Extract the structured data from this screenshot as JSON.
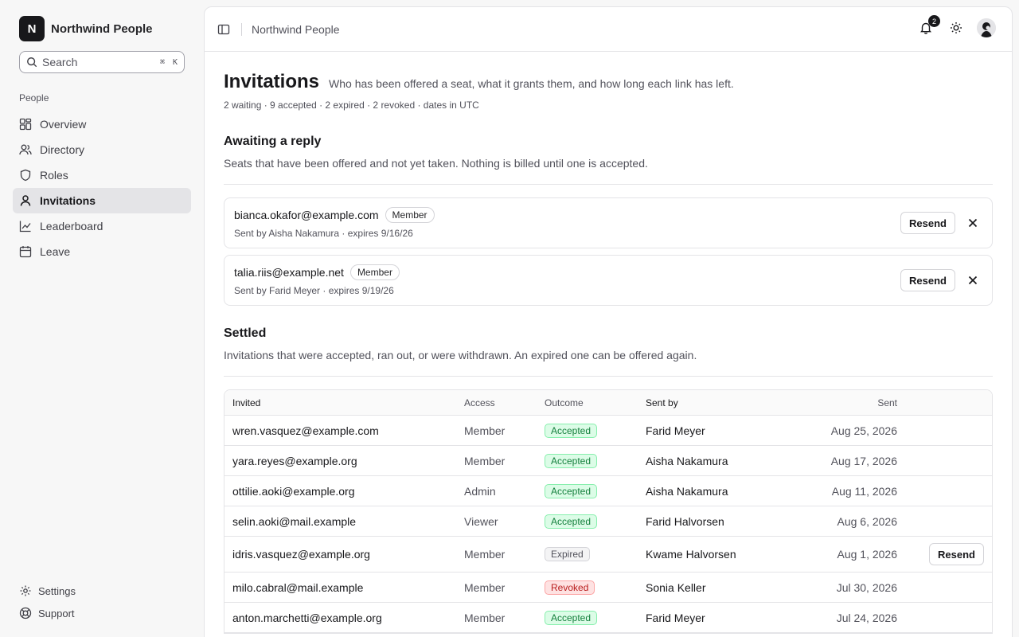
{
  "app": {
    "logo_letter": "N",
    "name": "Northwind People"
  },
  "search": {
    "placeholder": "Search",
    "shortcut_cmd": "⌘",
    "shortcut_key": "K"
  },
  "sidebar": {
    "section_label": "People",
    "items": [
      {
        "label": "Overview",
        "icon": "grid-icon"
      },
      {
        "label": "Directory",
        "icon": "users-icon"
      },
      {
        "label": "Roles",
        "icon": "shield-icon"
      },
      {
        "label": "Invitations",
        "icon": "user-icon",
        "active": true
      },
      {
        "label": "Leaderboard",
        "icon": "chart-line-icon"
      },
      {
        "label": "Leave",
        "icon": "calendar-icon"
      }
    ],
    "footer": [
      {
        "label": "Settings",
        "icon": "gear-icon"
      },
      {
        "label": "Support",
        "icon": "lifebuoy-icon"
      }
    ]
  },
  "topbar": {
    "breadcrumb": "Northwind People",
    "notification_count": "2"
  },
  "page": {
    "title": "Invitations",
    "subtitle": "Who has been offered a seat, what it grants them, and how long each link has left.",
    "stats": "2 waiting · 9 accepted · 2 expired · 2 revoked · dates in UTC"
  },
  "pending_section": {
    "title": "Awaiting a reply",
    "description": "Seats that have been offered and not yet taken. Nothing is billed until one is accepted.",
    "items": [
      {
        "email": "bianca.okafor@example.com",
        "role": "Member",
        "meta": "Sent by Aisha Nakamura · expires 9/16/26",
        "action": "Resend"
      },
      {
        "email": "talia.riis@example.net",
        "role": "Member",
        "meta": "Sent by Farid Meyer · expires 9/19/26",
        "action": "Resend"
      }
    ]
  },
  "settled_section": {
    "title": "Settled",
    "description": "Invitations that were accepted, ran out, or were withdrawn. An expired one can be offered again.",
    "columns": {
      "invited": "Invited",
      "access": "Access",
      "outcome": "Outcome",
      "sent_by": "Sent by",
      "sent": "Sent"
    },
    "rows": [
      {
        "invited": "wren.vasquez@example.com",
        "access": "Member",
        "outcome": "Accepted",
        "status": "accepted",
        "sent_by": "Farid Meyer",
        "sent": "Aug 25, 2026",
        "action": ""
      },
      {
        "invited": "yara.reyes@example.org",
        "access": "Member",
        "outcome": "Accepted",
        "status": "accepted",
        "sent_by": "Aisha Nakamura",
        "sent": "Aug 17, 2026",
        "action": ""
      },
      {
        "invited": "ottilie.aoki@example.org",
        "access": "Admin",
        "outcome": "Accepted",
        "status": "accepted",
        "sent_by": "Aisha Nakamura",
        "sent": "Aug 11, 2026",
        "action": ""
      },
      {
        "invited": "selin.aoki@mail.example",
        "access": "Viewer",
        "outcome": "Accepted",
        "status": "accepted",
        "sent_by": "Farid Halvorsen",
        "sent": "Aug 6, 2026",
        "action": ""
      },
      {
        "invited": "idris.vasquez@example.org",
        "access": "Member",
        "outcome": "Expired",
        "status": "expired",
        "sent_by": "Kwame Halvorsen",
        "sent": "Aug 1, 2026",
        "action": "Resend"
      },
      {
        "invited": "milo.cabral@mail.example",
        "access": "Member",
        "outcome": "Revoked",
        "status": "revoked",
        "sent_by": "Sonia Keller",
        "sent": "Jul 30, 2026",
        "action": ""
      },
      {
        "invited": "anton.marchetti@example.org",
        "access": "Member",
        "outcome": "Accepted",
        "status": "accepted",
        "sent_by": "Farid Meyer",
        "sent": "Jul 24, 2026",
        "action": ""
      }
    ]
  }
}
